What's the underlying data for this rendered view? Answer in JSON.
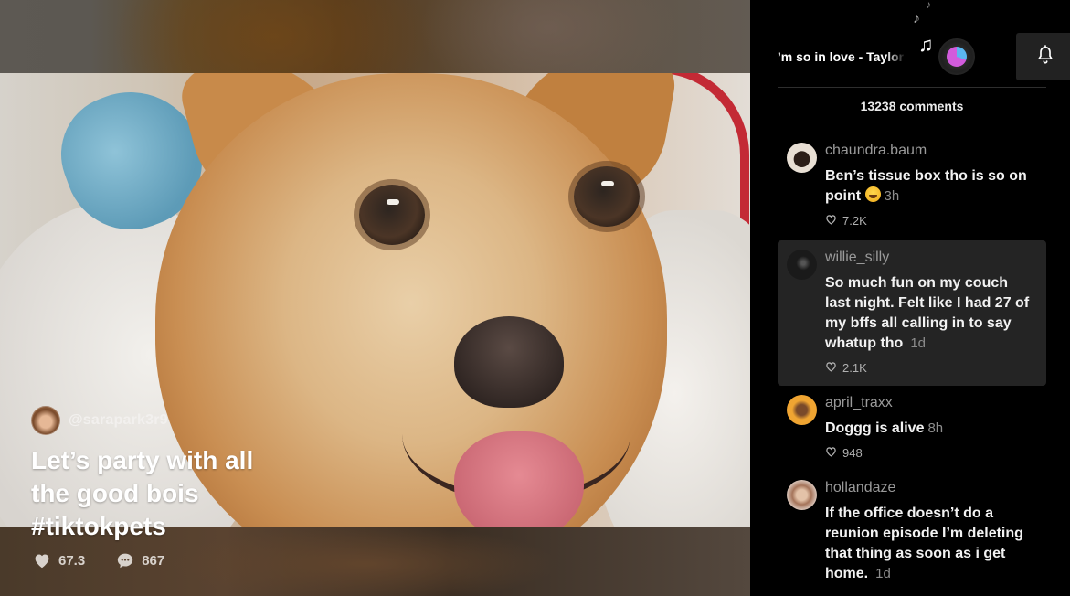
{
  "video": {
    "author": {
      "handle": "@sarapark3r9",
      "avatar_icon": "user-avatar"
    },
    "caption": "Let’s party with all the good bois #tiktokpets",
    "stats": {
      "likes": "67.3",
      "comments": "867"
    }
  },
  "sidebar": {
    "music": {
      "song_title": "I’m so in love - Taylor",
      "notes_icon": "music-notes-icon",
      "disc_icon": "music-disc-icon"
    },
    "notification_button": {
      "icon": "bell-icon"
    },
    "comment_count_label": "13238 comments",
    "comments": [
      {
        "username": "chaundra.baum",
        "text": "Ben’s tissue box tho is so on point",
        "emoji": "laughing-tears-emoji",
        "time": "3h",
        "likes": "7.2K",
        "highlighted": false,
        "avatar_color": "#e8dfd4"
      },
      {
        "username": "willie_silly",
        "text": "So much fun on my couch last night. Felt like I had 27 of my bffs all calling in to say whatup tho",
        "time": "1d",
        "likes": "2.1K",
        "highlighted": true,
        "avatar_color": "#1a1a1a"
      },
      {
        "username": "april_traxx",
        "text": "Doggg is alive",
        "time": "8h",
        "likes": "948",
        "highlighted": false,
        "avatar_color": "#f0a532"
      },
      {
        "username": "hollandaze",
        "text": "If the office doesn’t do a reunion episode I’m deleting that thing as soon as i get home.",
        "time": "1d",
        "likes": "",
        "highlighted": false,
        "avatar_color": "#d9c4b8"
      }
    ]
  }
}
